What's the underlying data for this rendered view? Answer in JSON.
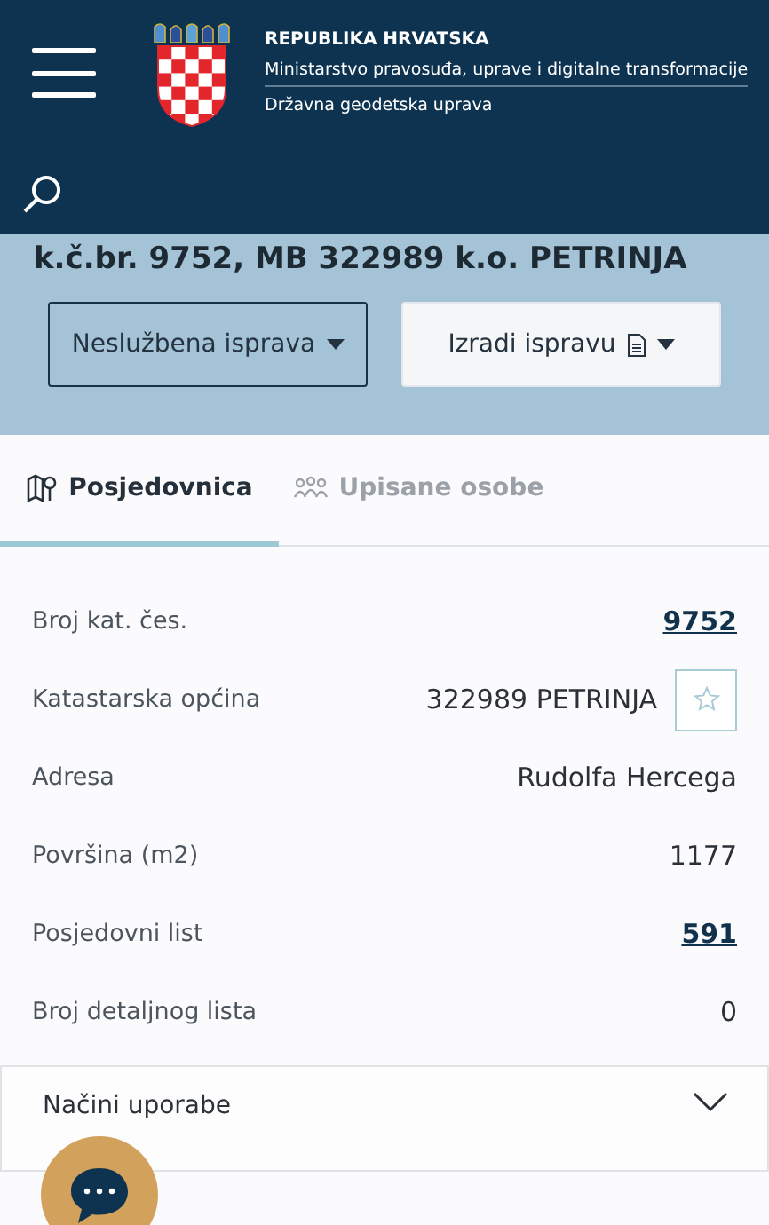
{
  "header": {
    "lines": [
      "REPUBLIKA HRVATSKA",
      "Ministarstvo pravosuđa, uprave i digitalne transformacije",
      "Državna geodetska uprava"
    ]
  },
  "heading": "k.č.br. 9752, MB 322989 k.o. PETRINJA",
  "buttons": [
    {
      "label": "Neslužbena isprava",
      "kind": "outline"
    },
    {
      "label": "Izradi ispravu",
      "kind": "document"
    }
  ],
  "tabs": [
    {
      "label": "Posjedovnica",
      "selected": true
    },
    {
      "label": "Upisane osobe",
      "selected": false
    }
  ],
  "fields": [
    {
      "label": "Broj kat. čes.",
      "value": "9752",
      "kind": "link"
    },
    {
      "label": "Katastarska općina",
      "value": "322989 PETRINJA",
      "kind": "favorite"
    },
    {
      "label": "Adresa",
      "value": "Rudolfa Hercega",
      "kind": "text"
    },
    {
      "label": "Površina (m2)",
      "value": "1177",
      "kind": "text"
    },
    {
      "label": "Posjedovni list",
      "value": "591",
      "kind": "link"
    },
    {
      "label": "Broj detaljnog lista",
      "value": "0",
      "kind": "text"
    }
  ],
  "accordion": {
    "label": "Načini uporabe",
    "expanded": false
  }
}
